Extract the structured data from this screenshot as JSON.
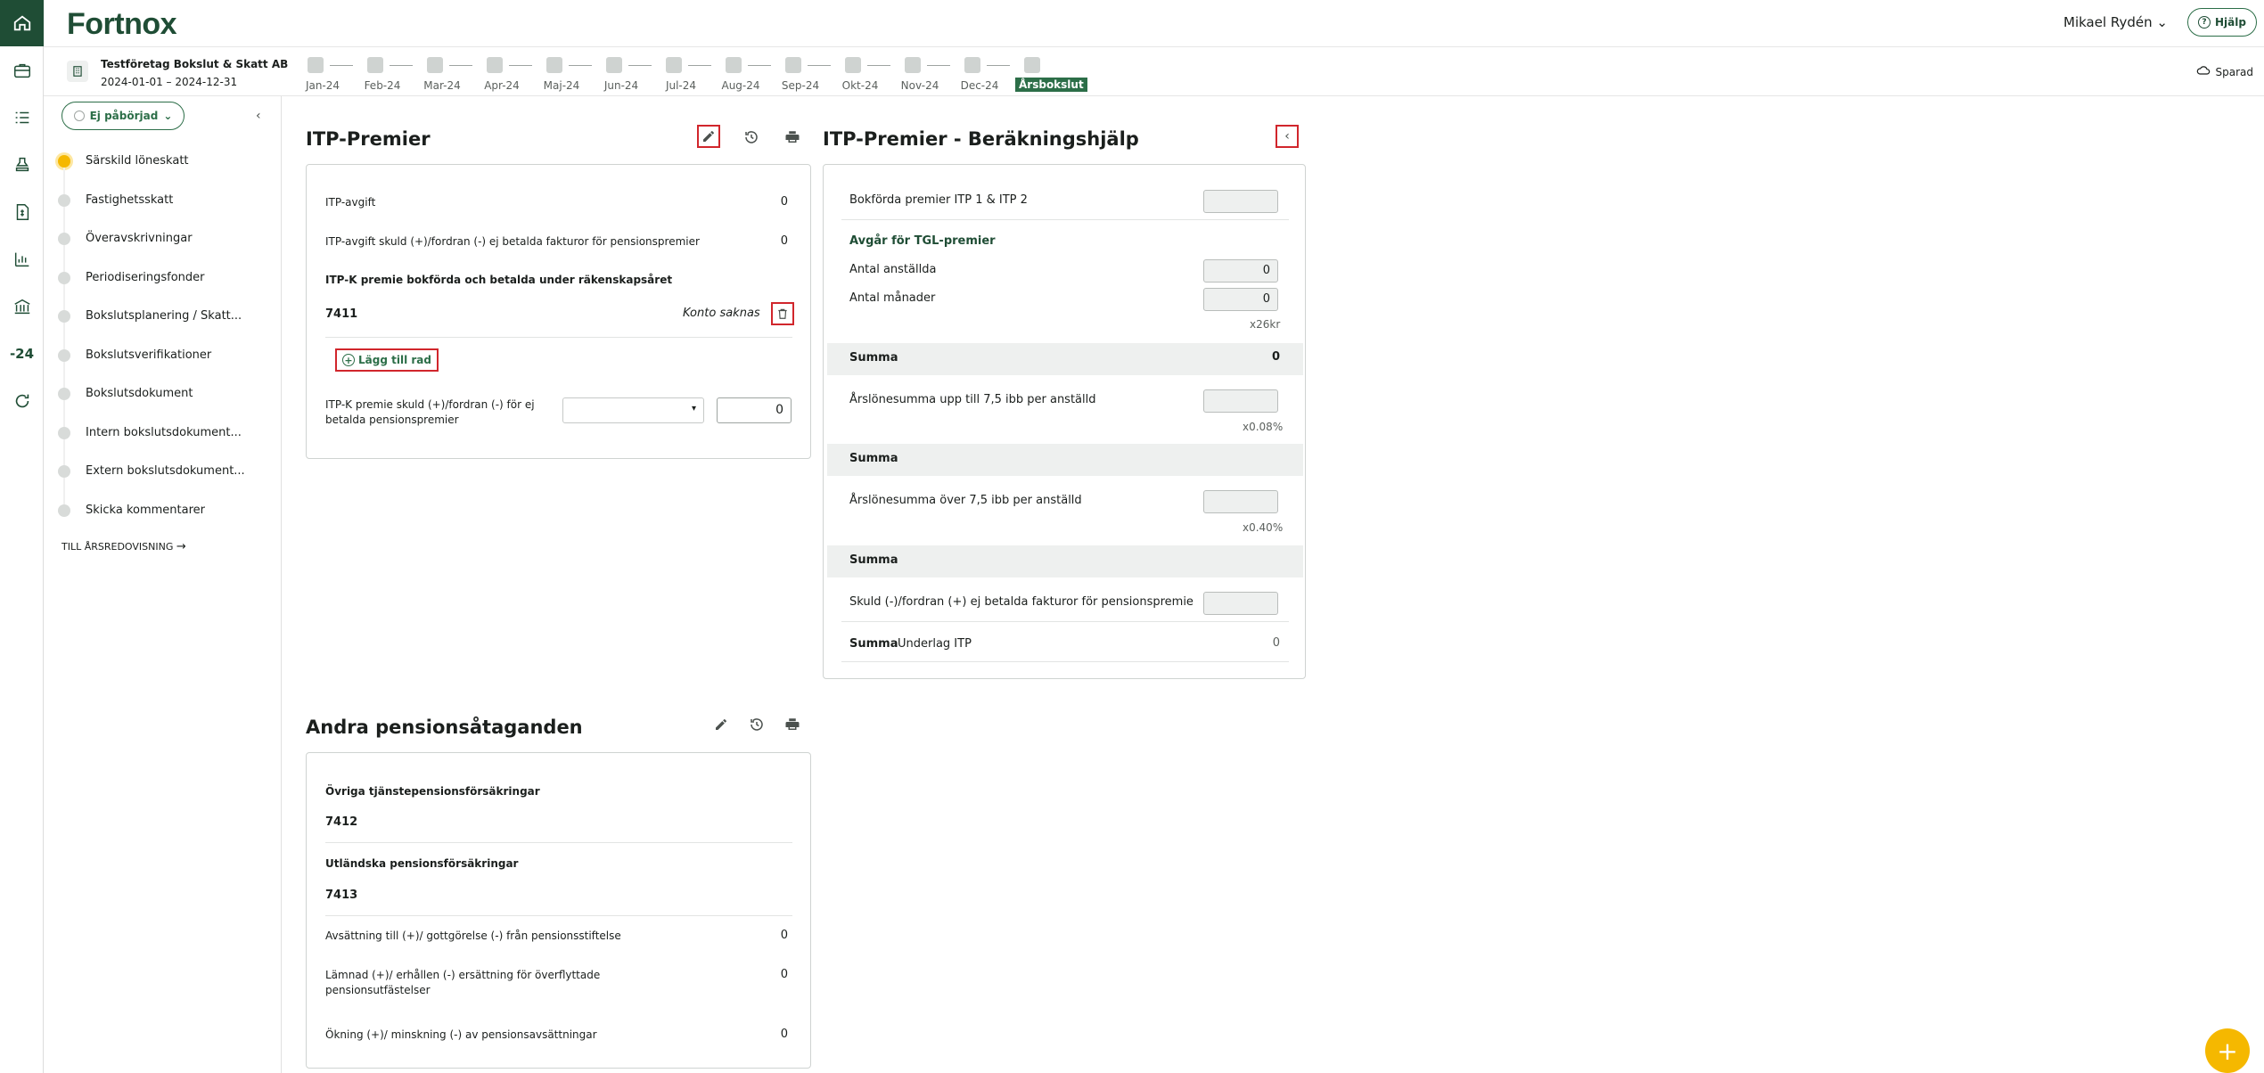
{
  "app": {
    "logo": "Fortnox",
    "user": "Mikael Rydén",
    "help": "Hjälp"
  },
  "company": {
    "name": "Testföretag Bokslut & Skatt AB",
    "period": "2024-01-01 – 2024-12-31",
    "saved": "Sparad"
  },
  "months": [
    "Jan-24",
    "Feb-24",
    "Mar-24",
    "Apr-24",
    "Maj-24",
    "Jun-24",
    "Jul-24",
    "Aug-24",
    "Sep-24",
    "Okt-24",
    "Nov-24",
    "Dec-24",
    "Årsbokslut"
  ],
  "rail": {
    "year_label": "-24"
  },
  "sidebar": {
    "status": "Ej påbörjad",
    "items": [
      "Särskild löneskatt",
      "Fastighetsskatt",
      "Överavskrivningar",
      "Periodiseringsfonder",
      "Bokslutsplanering / Skatt...",
      "Bokslutsverifikationer",
      "Bokslutsdokument",
      "Intern bokslutsdokument...",
      "Extern bokslutsdokument...",
      "Skicka kommentarer"
    ],
    "to_report": "TILL ÅRSREDOVISNING"
  },
  "itp": {
    "title": "ITP-Premier",
    "rows": [
      {
        "label": "ITP-avgift",
        "value": "0"
      },
      {
        "label": "ITP-avgift skuld (+)/fordran (-) ej betalda fakturor för pensionspremier",
        "value": "0"
      }
    ],
    "itpk_heading": "ITP-K premie bokförda och betalda under räkenskapsåret",
    "account": "7411",
    "account_missing": "Konto saknas",
    "add_row": "Lägg till rad",
    "itpk_debt_label_1": "ITP-K premie skuld (+)/fordran (-) för ej",
    "itpk_debt_label_2": "betalda pensionspremier",
    "itpk_debt_value": "0"
  },
  "calc": {
    "title": "ITP-Premier - Beräkningshjälp",
    "booked_label": "Bokförda premier ITP 1 & ITP 2",
    "tgl_heading": "Avgår för TGL-premier",
    "employees_label": "Antal anställda",
    "employees_value": "0",
    "months_label": "Antal månader",
    "months_value": "0",
    "factor1": "x26kr",
    "summa": "Summa",
    "summa1_value": "0",
    "salary_upto_label": "Årslönesumma upp till 7,5 ibb per anställd",
    "factor2": "x0.08%",
    "salary_over_label": "Årslönesumma över 7,5 ibb per anställd",
    "factor3": "x0.40%",
    "debt_label": "Skuld (-)/fordran (+) ej betalda fakturor för pensionspremie",
    "basis_label": "Underlag ITP",
    "basis_value": "0"
  },
  "other": {
    "title": "Andra pensionsåtaganden",
    "h1": "Övriga tjänstepensionsförsäkringar",
    "acc1": "7412",
    "h2": "Utländska pensionsförsäkringar",
    "acc2": "7413",
    "rows": [
      {
        "label": "Avsättning till (+)/ gottgörelse (-) från pensionsstiftelse",
        "value": "0"
      },
      {
        "label": "Lämnad (+)/ erhållen (-) ersättning för överflyttade",
        "label2": "pensionsutfästelser",
        "value": "0"
      },
      {
        "label": "Ökning (+)/ minskning (-) av pensionsavsättningar",
        "value": "0"
      }
    ]
  },
  "colors": {
    "brand": "#1f4d35",
    "accent": "#2c6e48",
    "highlight": "#d1262c",
    "active_step": "#f5b800"
  }
}
